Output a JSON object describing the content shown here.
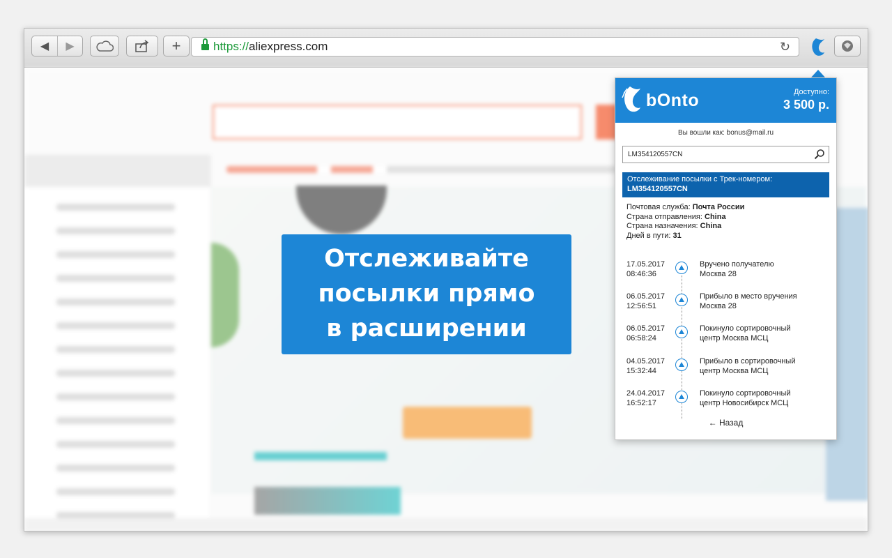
{
  "browser": {
    "url_scheme": "https://",
    "url_host": "aliexpress.com",
    "nav_back_symbol": "◀",
    "nav_forward_symbol": "▶",
    "plus_symbol": "+",
    "reload_symbol": "↻"
  },
  "promo": {
    "line1": "Отслеживайте",
    "line2": "посылки прямо",
    "line3": "в расширении"
  },
  "extension": {
    "brand": "bOnto",
    "balance_label": "Доступно:",
    "balance_value": "3 500 р.",
    "logged_in": "Вы вошли как: bonus@mail.ru",
    "search_value": "LM354120557CN",
    "tracking_title": "Отслеживание посылки с Трек-номером:",
    "tracking_number": "LM354120557CN",
    "postal_service_label": "Почтовая служба:",
    "postal_service_value": "Почта России",
    "origin_label": "Страна отправления:",
    "origin_value": "China",
    "destination_label": "Страна назначения:",
    "destination_value": "China",
    "days_label": "Дней в пути:",
    "days_value": "31",
    "events": [
      {
        "date": "17.05.2017",
        "time": "08:46:36",
        "status": "Вручено получателю",
        "place": "Москва 28"
      },
      {
        "date": "06.05.2017",
        "time": "12:56:51",
        "status": "Прибыло в место вручения",
        "place": "Москва 28"
      },
      {
        "date": "06.05.2017",
        "time": "06:58:24",
        "status": "Покинуло сортировочный",
        "place": "центр Москва МСЦ"
      },
      {
        "date": "04.05.2017",
        "time": "15:32:44",
        "status": "Прибыло в сортировочный",
        "place": "центр Москва МСЦ"
      },
      {
        "date": "24.04.2017",
        "time": "16:52:17",
        "status": "Покинуло сортировочный",
        "place": "центр Новосибирск МСЦ"
      }
    ],
    "back_label": "← Назад"
  },
  "colors": {
    "accent": "#1d86d6",
    "header_dark": "#0d63ad",
    "secure": "#1d9a3a"
  }
}
